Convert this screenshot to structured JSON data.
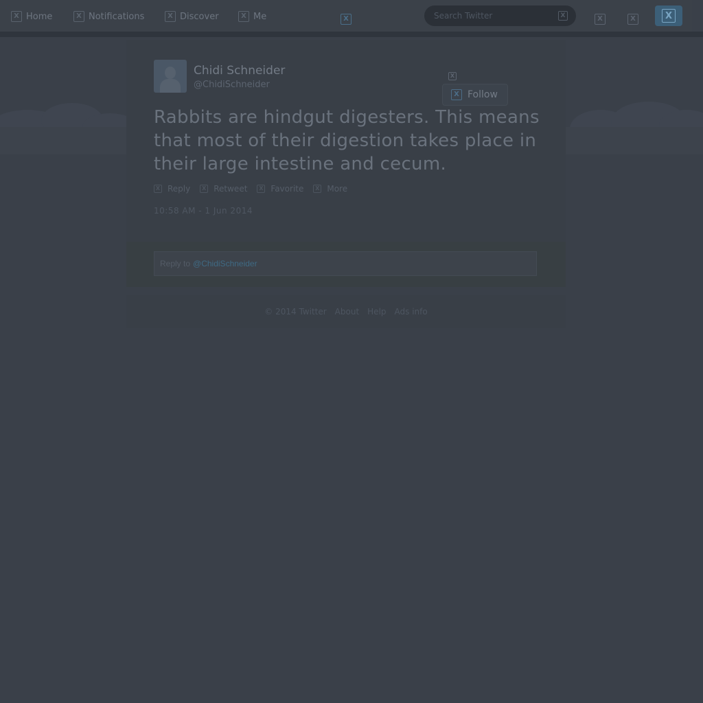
{
  "nav": {
    "home": "Home",
    "notifications": "Notifications",
    "discover": "Discover",
    "me": "Me"
  },
  "search": {
    "placeholder": "Search Twitter"
  },
  "tweet": {
    "author_name": "Chidi Schneider",
    "author_handle": "@ChidiSchneider",
    "follow_label": "Follow",
    "text": "Rabbits are hindgut digesters. This means that most of their digestion takes place in their large intestine and cecum.",
    "actions": {
      "reply": "Reply",
      "retweet": "Retweet",
      "favorite": "Favorite",
      "more": "More"
    },
    "timestamp": "10:58 AM - 1 Jun 2014",
    "reply_prefix": "Reply to",
    "reply_mention": "@ChidiSchneider"
  },
  "footer": {
    "copyright": "© 2014 Twitter",
    "about": "About",
    "help": "Help",
    "ads_info": "Ads info"
  },
  "colors": {
    "overlay_background": "#3a4049",
    "accent": "#3f6a84"
  }
}
